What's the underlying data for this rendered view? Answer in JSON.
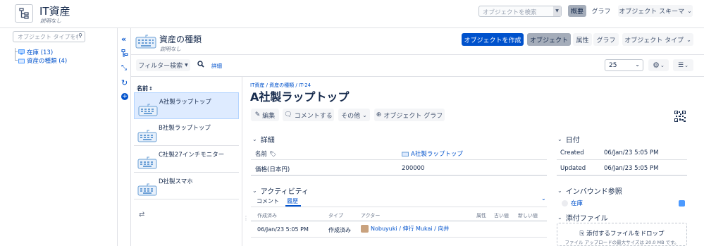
{
  "header": {
    "title": "IT資産",
    "subtitle": "説明なし",
    "search_placeholder": "オブジェクトを検索",
    "tab_overview": "概要",
    "tab_graph": "グラフ",
    "schema_button": "オブジェクト スキーマ"
  },
  "sidebar": {
    "search_placeholder": "オブジェクト タイプを検索",
    "tree": [
      {
        "label": "在庫 (13)"
      },
      {
        "label": "資産の種類 (4)"
      }
    ]
  },
  "type_header": {
    "title": "資産の種類",
    "subtitle": "説明なし",
    "create_button": "オブジェクトを作成",
    "tab_objects": "オブジェクト",
    "tab_attributes": "属性",
    "tab_graph": "グラフ",
    "object_type_button": "オブジェクト タイプ"
  },
  "toolbar": {
    "filter_button": "フィルター検索",
    "detail_link": "詳細",
    "page_size": "25"
  },
  "list": {
    "sort_label": "名前",
    "items": [
      {
        "label": "A社製ラップトップ"
      },
      {
        "label": "B社製ラップトップ"
      },
      {
        "label": "C社製27インチモニター"
      },
      {
        "label": "D社製スマホ"
      }
    ]
  },
  "detail": {
    "breadcrumb": [
      "IT資産",
      "資産の種類",
      "IT-24"
    ],
    "title": "A社製ラップトップ",
    "actions": {
      "edit": "編集",
      "comment": "コメントする",
      "more": "その他",
      "graph": "オブジェクト グラフ"
    },
    "details_section": {
      "heading": "詳細",
      "rows": [
        {
          "key": "名前",
          "value": "A社製ラップトップ"
        },
        {
          "key": "価格(日本円)",
          "value": "200000"
        }
      ]
    },
    "activity_section": {
      "heading": "アクティビティ",
      "tab_comment": "コメント",
      "tab_history": "履歴",
      "columns": [
        "作成済み",
        "タイプ",
        "アクター",
        "属性",
        "古い値",
        "新しい値"
      ],
      "rows": [
        {
          "created": "06/Jan/23 5:05 PM",
          "type": "作成済み",
          "actor": "Nobuyuki / 伸行 Mukai / 向井"
        }
      ]
    },
    "dates_section": {
      "heading": "日付",
      "created_label": "Created",
      "created_value": "06/Jan/23 5:05 PM",
      "updated_label": "Updated",
      "updated_value": "06/Jan/23 5:05 PM"
    },
    "inbound_section": {
      "heading": "インバウンド参照",
      "item": "在庫"
    },
    "attachments_section": {
      "heading": "添付ファイル",
      "drop_text": "添付するファイルをドロップ",
      "limit_text": "ファイル アップロードの最大サイズは 20.0 MB です。"
    }
  },
  "colors": {
    "brand_blue": "#0052cc",
    "selected_row": "#deebff",
    "border": "#dfe1e6",
    "icon_blue": "#6a9fd6"
  }
}
